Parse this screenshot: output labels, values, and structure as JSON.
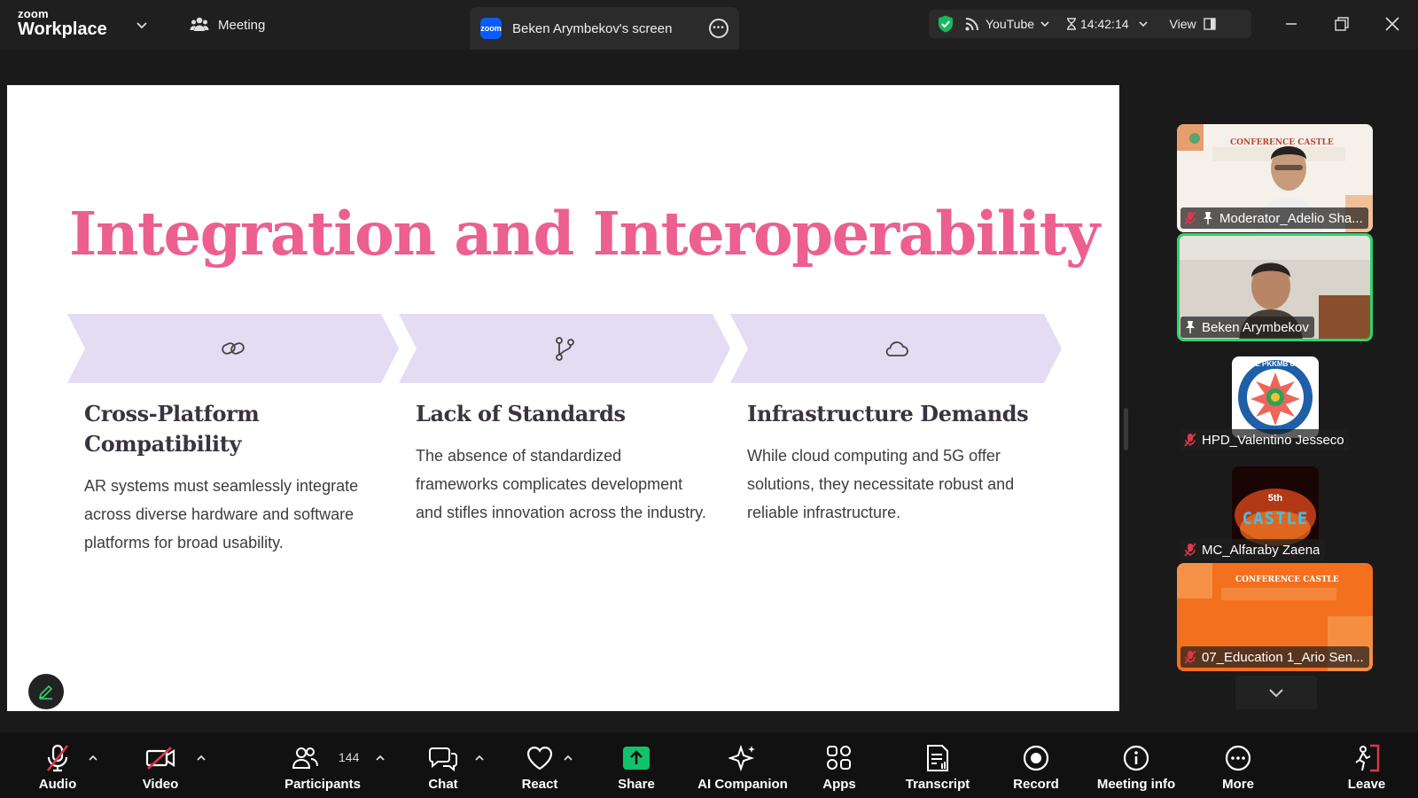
{
  "app": {
    "logo_line1": "zoom",
    "logo_line2": "Workplace",
    "meeting_tab": "Meeting",
    "screen_tab": "Beken Arymbekov's screen",
    "zoom_badge": "zoom",
    "live_stream": "YouTube",
    "timer": "14:42:14",
    "view_label": "View"
  },
  "slide": {
    "title": "Integration and Interoperability",
    "title_color": "#ec5f8f",
    "chevron_color": "#e3dcf3",
    "cards": [
      {
        "icon": "link-icon",
        "heading": "Cross-Platform Compatibility",
        "body": "AR systems must seamlessly integrate across diverse hardware and software platforms for broad usability."
      },
      {
        "icon": "git-branch-icon",
        "heading": "Lack of Standards",
        "body": "The absence of standardized frameworks complicates development and stifles innovation across the industry."
      },
      {
        "icon": "cloud-icon",
        "heading": "Infrastructure Demands",
        "body": "While cloud computing and 5G offer solutions, they necessitate robust and reliable infrastructure."
      }
    ]
  },
  "participants": [
    {
      "name": "Moderator_Adelio Sha...",
      "muted": true,
      "pinned": true,
      "video": true,
      "active_speaker": false
    },
    {
      "name": "Beken Arymbekov",
      "muted": false,
      "pinned": true,
      "video": true,
      "active_speaker": true
    },
    {
      "name": "HPD_Valentino Jesseco",
      "muted": true,
      "pinned": false,
      "video": false,
      "avatar_text": "TIPE PKKMB UNJ"
    },
    {
      "name": "MC_Alfaraby Zaena",
      "muted": true,
      "pinned": false,
      "video": false,
      "avatar_text_top": "5th",
      "avatar_text_main": "CASTLE"
    },
    {
      "name": "07_Education 1_Ario Sen...",
      "muted": true,
      "pinned": false,
      "video": true,
      "active_speaker": false
    }
  ],
  "tile_texts": {
    "conference": "CONFERENCE CASTLE"
  },
  "toolbar": {
    "audio": "Audio",
    "video": "Video",
    "participants": "Participants",
    "participants_count": "144",
    "chat": "Chat",
    "react": "React",
    "share": "Share",
    "ai_companion": "AI Companion",
    "apps": "Apps",
    "transcript": "Transcript",
    "record": "Record",
    "meeting_info": "Meeting info",
    "more": "More",
    "leave": "Leave"
  },
  "colors": {
    "share_green": "#12c36b",
    "muted_red": "#e0364b",
    "speaker_border": "#2fd46b",
    "accent_blue": "#0b5cff",
    "leave_red": "#e0364b"
  }
}
